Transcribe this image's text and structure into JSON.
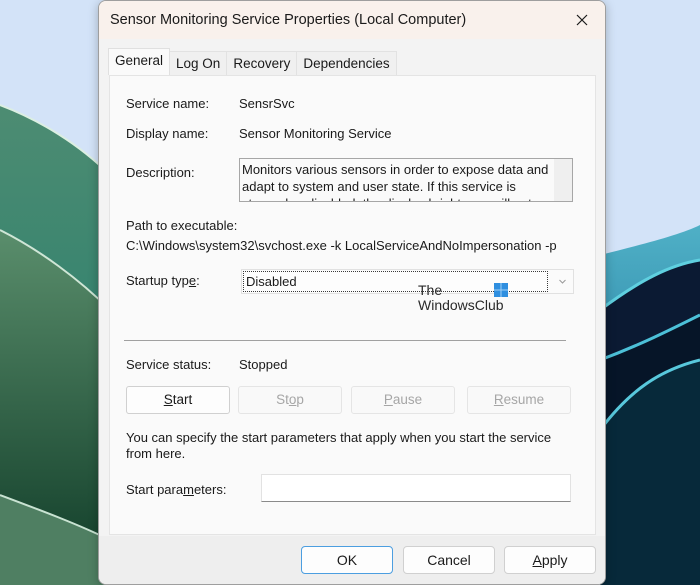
{
  "window": {
    "title": "Sensor Monitoring Service Properties (Local Computer)",
    "close_icon": "close-icon"
  },
  "tabs": [
    {
      "label": "General",
      "active": true
    },
    {
      "label": "Log On",
      "active": false
    },
    {
      "label": "Recovery",
      "active": false
    },
    {
      "label": "Dependencies",
      "active": false
    }
  ],
  "general": {
    "service_name_label": "Service name:",
    "service_name": "SensrSvc",
    "display_name_label": "Display name:",
    "display_name": "Sensor Monitoring Service",
    "description_label": "Description:",
    "description": "Monitors various sensors in order to expose data and adapt to system and user state.  If this service is stopped or disabled, the display brightness will not adapt to lighting conditions.",
    "path_label": "Path to executable:",
    "path": "C:\\Windows\\system32\\svchost.exe -k LocalServiceAndNoImpersonation -p",
    "startup_type_label_pre": "Startup typ",
    "startup_type_label_ul": "e",
    "startup_type_label_post": ":",
    "startup_type_value": "Disabled",
    "service_status_label": "Service status:",
    "service_status": "Stopped",
    "buttons": {
      "start": {
        "pre": "",
        "ul": "S",
        "post": "tart",
        "enabled": true
      },
      "stop": {
        "pre": "St",
        "ul": "o",
        "post": "p",
        "enabled": false
      },
      "pause": {
        "pre": "",
        "ul": "P",
        "post": "ause",
        "enabled": false
      },
      "resume": {
        "pre": "",
        "ul": "R",
        "post": "esume",
        "enabled": false
      }
    },
    "info_line1": "You can specify the start parameters that apply when you start the service",
    "info_line2": "from here.",
    "start_params_label_pre": "Start para",
    "start_params_label_ul": "m",
    "start_params_label_post": "eters:",
    "start_params_value": ""
  },
  "watermark": {
    "line1": "The",
    "line2": "WindowsClub",
    "logo_color": "#2f8fe0"
  },
  "footer": {
    "ok": "OK",
    "cancel": "Cancel",
    "apply_ul": "A",
    "apply_post": "pply"
  },
  "colors": {
    "titlebar": "#f9f1ec",
    "accent_border": "#4c9ee0",
    "disabled_text": "#a6a6a6"
  }
}
